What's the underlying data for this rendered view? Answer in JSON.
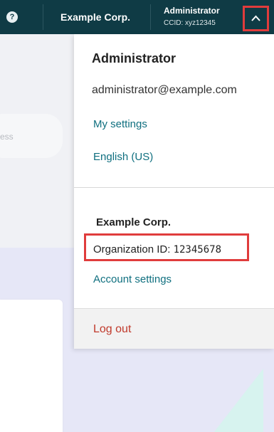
{
  "topbar": {
    "help_icon": "question-circle-icon",
    "org_name": "Example Corp.",
    "user_name": "Administrator",
    "ccid": "CCID: xyz12345",
    "toggle_icon": "chevron-up-icon"
  },
  "background": {
    "field_text": "ess"
  },
  "dropdown": {
    "user_name": "Administrator",
    "email": "administrator@example.com",
    "my_settings": "My settings",
    "language": "English (US)",
    "org_name": "Example Corp.",
    "org_id_label": "Organization ID:",
    "org_id_value": "12345678",
    "account_settings": "Account settings",
    "logout": "Log out"
  },
  "colors": {
    "topbar": "#0f3b45",
    "link": "#0f6f7f",
    "highlight": "#e03c3c",
    "logout": "#c0392b"
  }
}
